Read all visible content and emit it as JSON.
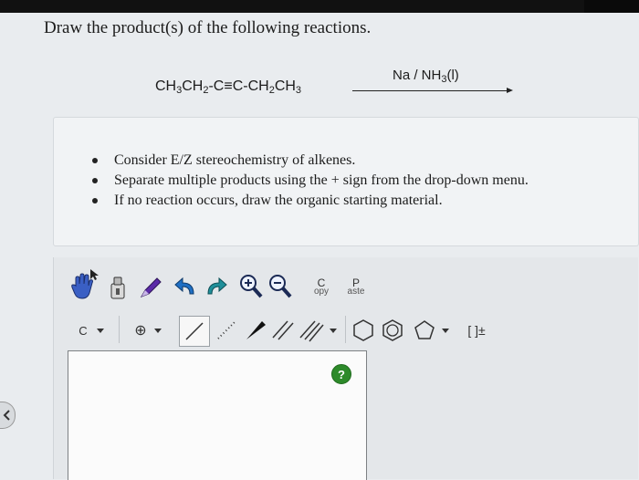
{
  "question": "Draw the product(s) of the following reactions.",
  "reaction": {
    "p1": "CH",
    "s1": "3",
    "p2": "CH",
    "s2": "2",
    "p3": "-C≡C-CH",
    "s3": "2",
    "p4": "CH",
    "s4": "3",
    "reagent_main": "Na / NH",
    "reagent_sub": "3",
    "reagent_tail": "(l)"
  },
  "notes": [
    "Consider E/Z stereochemistry of alkenes.",
    "Separate multiple products using the + sign from the drop-down menu.",
    "If no reaction occurs, draw the organic starting material."
  ],
  "toolbar_row1": {
    "copy_top": "C",
    "copy_bottom": "opy",
    "paste_top": "P",
    "paste_bottom": "aste"
  },
  "toolbar_row2": {
    "atom_label": "C",
    "charge_symbol": "⊕",
    "template_label": "[ ]±"
  },
  "help_label": "?",
  "colors": {
    "help_green": "#2d8a2a",
    "tool_blue": "#2f5fc9",
    "tool_purple": "#5b2aa8",
    "tool_teal": "#1f8f9a"
  },
  "icons": [
    "hand-icon",
    "eraser-icon",
    "pencil-icon",
    "undo-icon",
    "redo-icon",
    "zoom-in-icon",
    "zoom-out-icon",
    "single-bond-icon",
    "wedge-bond-icon",
    "hash-bond-icon",
    "double-bond-icon",
    "triple-bond-icon",
    "hexagon-ring-icon",
    "benzene-ring-icon",
    "pentagon-ring-icon"
  ]
}
